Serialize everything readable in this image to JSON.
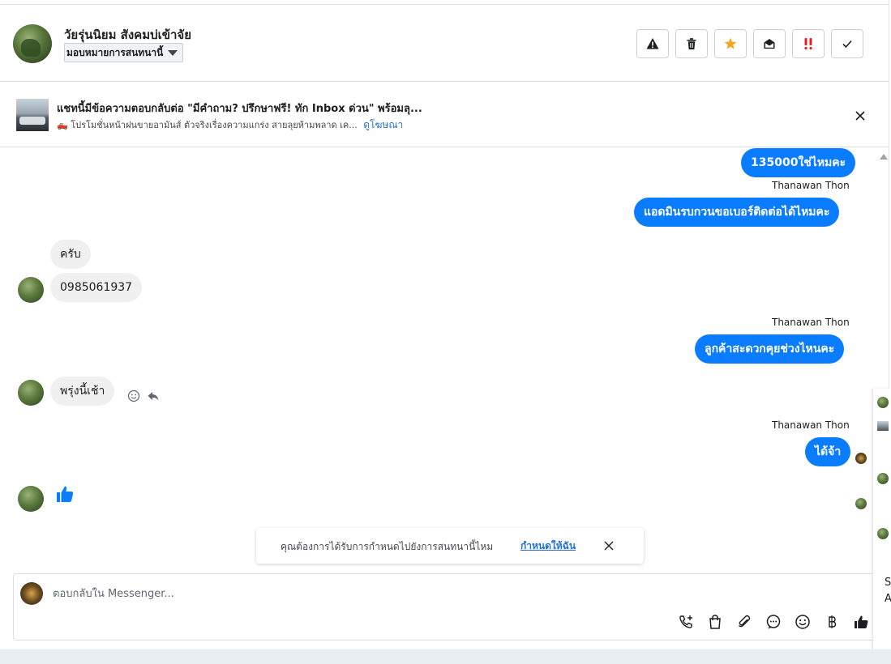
{
  "header": {
    "contact_name": "วัยรุ่นนิยม สังคมบ่เข้าจัย",
    "assign_label": "มอบหมายการสนทนานี้",
    "actions": [
      "warning-icon",
      "trash-icon",
      "star-icon",
      "mark-unread-icon",
      "urgent-icon",
      "check-icon"
    ],
    "colors": {
      "star": "#f5a623",
      "urgent": "#e02020"
    }
  },
  "ad": {
    "title": "แชทนี้มีข้อความตอบกลับต่อ \"มีคำถาม? ปรึกษาฟรี! ทัก Inbox ด่วน\" พร้อมลุ...",
    "subtitle": "🛻 โปรโมชั่นหน้าฝนขายอามันส์ ตัวจริงเรื่องความแกร่ง สายลุยห้ามพลาด เค...",
    "link": "ดูโฆษณา"
  },
  "messages": [
    {
      "side": "out",
      "text": "135000ใช่ไหมคะ"
    },
    {
      "side": "out",
      "sender": "Thanawan Thon",
      "text": "แอดมินรบกวนขอเบอร์ติดต่อได้ไหมคะ"
    },
    {
      "side": "in",
      "text": "ครับ"
    },
    {
      "side": "in",
      "text": "0985061937"
    },
    {
      "side": "out",
      "sender": "Thanawan Thon",
      "text": "ลูกค้าสะดวกคุยช่วงไหนคะ"
    },
    {
      "side": "in",
      "text": "พรุ่งนี้เช้า"
    },
    {
      "side": "out",
      "sender": "Thanawan Thon",
      "text": "ได้จ้า"
    },
    {
      "side": "in",
      "text": "thumbs-up-icon"
    }
  ],
  "toast": {
    "text": "คุณต้องการได้รับการกำหนดไปยังการสนทนานี้ไหม",
    "link": "กำหนดให้ฉัน"
  },
  "composer": {
    "placeholder": "ตอบกลับใน Messenger...",
    "tools": [
      "call-add-icon",
      "shopping-bag-icon",
      "attachment-icon",
      "saved-reply-icon",
      "emoji-icon",
      "baht-icon",
      "like-icon"
    ],
    "accent": "#0a7cff"
  },
  "side_panel": {
    "letters": [
      "S",
      "A"
    ]
  }
}
